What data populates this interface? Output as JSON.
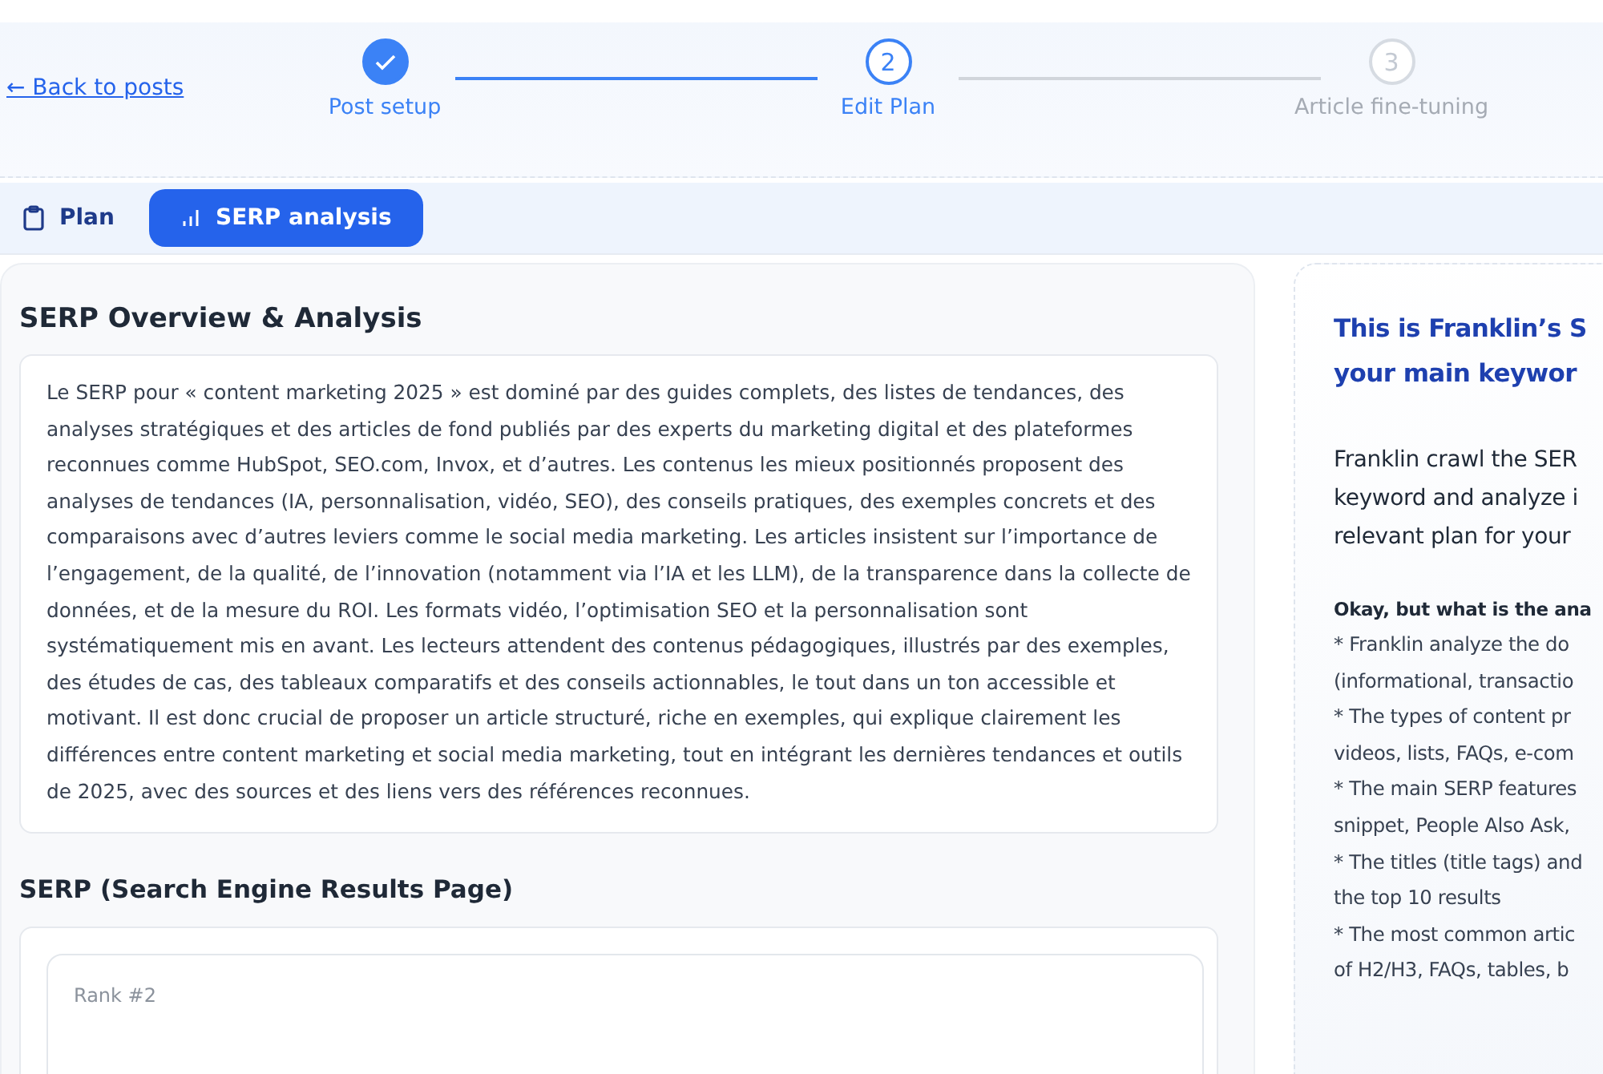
{
  "back_link": "← Back to posts",
  "steps": [
    {
      "label": "Post setup",
      "kind": "done"
    },
    {
      "label": "Edit Plan",
      "kind": "current",
      "number": "2"
    },
    {
      "label": "Article fine-tuning",
      "kind": "upcoming",
      "number": "3"
    }
  ],
  "tabs": [
    {
      "label": "Plan",
      "selected": false
    },
    {
      "label": "SERP analysis",
      "selected": true
    }
  ],
  "overview": {
    "title": "SERP Overview & Analysis",
    "text": "Le SERP pour « content marketing 2025 » est dominé par des guides complets, des listes de tendances, des analyses stratégiques et des articles de fond publiés par des experts du marketing digital et des plateformes reconnues comme HubSpot, SEO.com, Invox, et d’autres. Les contenus les mieux positionnés proposent des analyses de tendances (IA, personnalisation, vidéo, SEO), des conseils pratiques, des exemples concrets et des comparaisons avec d’autres leviers comme le social media marketing. Les articles insistent sur l’importance de l’engagement, de la qualité, de l’innovation (notamment via l’IA et les LLM), de la transparence dans la collecte de données, et de la mesure du ROI. Les formats vidéo, l’optimisation SEO et la personnalisation sont systématiquement mis en avant. Les lecteurs attendent des contenus pédagogiques, illustrés par des exemples, des études de cas, des tableaux comparatifs et des conseils actionnables, le tout dans un ton accessible et motivant. Il est donc crucial de proposer un article structuré, riche en exemples, qui explique clairement les différences entre content marketing et social media marketing, tout en intégrant les dernières tendances et outils de 2025, avec des sources et des liens vers des références reconnues."
  },
  "serp": {
    "title": "SERP (Search Engine Results Page)",
    "results": [
      {
        "rank": "Rank #2"
      }
    ]
  },
  "info_panel": {
    "title_lines": [
      "This is Franklin’s S",
      "your main keywor"
    ],
    "intro_lines": [
      "Franklin crawl the SER",
      "keyword and analyze i",
      "relevant plan for your"
    ],
    "question": "Okay, but what is the ana",
    "list_lines": [
      "* Franklin analyze the do",
      "(informational, transactio",
      "* The types of content pr",
      "videos, lists, FAQs, e-com",
      "* The main SERP features",
      "snippet, People Also Ask,",
      "* The titles (title tags) and",
      "the top 10 results",
      "* The most common artic",
      "of H2/H3, FAQs, tables, b"
    ]
  }
}
